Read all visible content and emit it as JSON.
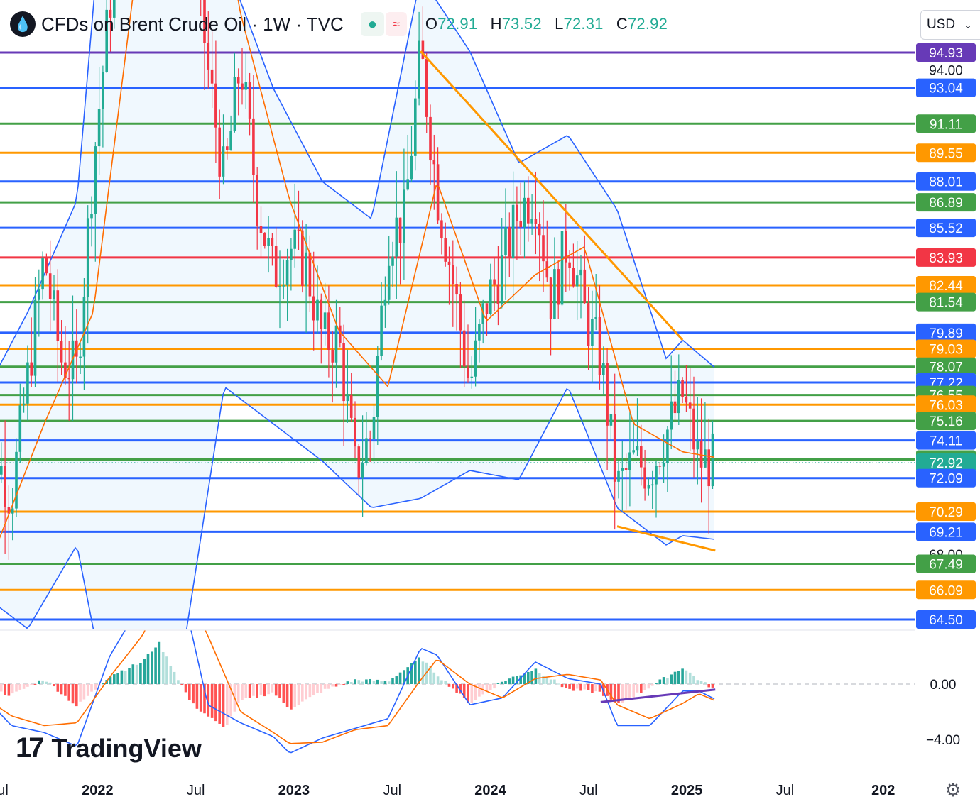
{
  "header": {
    "symbol_icon": "oil-drop-icon",
    "title": "CFDs on Brent Crude Oil · 1W · TVC",
    "indicator_status_icon": "dot-icon",
    "indicator_wave_icon": "wave-icon",
    "ohlc": {
      "o_label": "O",
      "o_value": "72.91",
      "h_label": "H",
      "h_value": "73.52",
      "l_label": "L",
      "l_value": "72.31",
      "c_label": "C",
      "c_value": "72.92"
    },
    "currency": "USD"
  },
  "brand": {
    "name": "TradingView",
    "mark": "17"
  },
  "settings_icon": "gear-icon",
  "colors": {
    "up": "#22ab94",
    "down": "#f23645",
    "bb": "#2962ff",
    "bb_fill": "#e3f2fd",
    "ema": "#ff6d00",
    "purple": "#673ab7",
    "blue": "#2962ff",
    "green": "#43a047",
    "orange": "#ff9800",
    "red": "#f23645",
    "trend": "#ff9800"
  },
  "chart_data": [
    {
      "type": "candlestick",
      "title": "CFDs on Brent Crude Oil · 1W · TVC",
      "x_ticks": [
        "Jul",
        "2022",
        "Jul",
        "2023",
        "Jul",
        "2024",
        "Jul",
        "2025",
        "Jul",
        "202"
      ],
      "y_ticks": [
        "94.00",
        "68.00"
      ],
      "last_price": 72.92,
      "price_levels": [
        {
          "value": 94.93,
          "label": "94.93",
          "color": "purple"
        },
        {
          "value": 93.04,
          "label": "93.04",
          "color": "blue"
        },
        {
          "value": 91.11,
          "label": "91.11",
          "color": "green"
        },
        {
          "value": 89.55,
          "label": "89.55",
          "color": "orange"
        },
        {
          "value": 88.01,
          "label": "88.01",
          "color": "blue"
        },
        {
          "value": 86.89,
          "label": "86.89",
          "color": "green"
        },
        {
          "value": 85.52,
          "label": "85.52",
          "color": "blue"
        },
        {
          "value": 83.93,
          "label": "83.93",
          "color": "red"
        },
        {
          "value": 82.44,
          "label": "82.44",
          "color": "orange"
        },
        {
          "value": 81.54,
          "label": "81.54",
          "color": "green"
        },
        {
          "value": 79.89,
          "label": "79.89",
          "color": "blue"
        },
        {
          "value": 79.03,
          "label": "79.03",
          "color": "orange"
        },
        {
          "value": 78.07,
          "label": "78.07",
          "color": "green"
        },
        {
          "value": 77.22,
          "label": "77.22",
          "color": "blue"
        },
        {
          "value": 76.55,
          "label": "76.55",
          "color": "green"
        },
        {
          "value": 76.03,
          "label": "76.03",
          "color": "orange"
        },
        {
          "value": 75.16,
          "label": "75.16",
          "color": "green"
        },
        {
          "value": 74.11,
          "label": "74.11",
          "color": "blue"
        },
        {
          "value": 73.09,
          "label": "73.09",
          "color": "green"
        },
        {
          "value": 72.92,
          "label": "72.92",
          "color": "last"
        },
        {
          "value": 72.09,
          "label": "72.09",
          "color": "blue"
        },
        {
          "value": 70.29,
          "label": "70.29",
          "color": "orange"
        },
        {
          "value": 69.21,
          "label": "69.21",
          "color": "blue"
        },
        {
          "value": 67.49,
          "label": "67.49",
          "color": "green"
        },
        {
          "value": 66.09,
          "label": "66.09",
          "color": "orange"
        },
        {
          "value": 64.5,
          "label": "64.50",
          "color": "blue"
        }
      ],
      "series": [
        {
          "kind": "candles",
          "close_path": [
            [
              "2021-06",
              75.5
            ],
            [
              "2021-07",
              73.5
            ],
            [
              "2021-08",
              71.0
            ],
            [
              "2021-09",
              77.5
            ],
            [
              "2021-10",
              84.0
            ],
            [
              "2021-11",
              78.5
            ],
            [
              "2021-12",
              77.8
            ],
            [
              "2022-01",
              89.0
            ],
            [
              "2022-02",
              97.5
            ],
            [
              "2022-03",
              106.0
            ],
            [
              "2022-04",
              107.0
            ],
            [
              "2022-05",
              118.0
            ],
            [
              "2022-06",
              114.0
            ],
            [
              "2022-07",
              102.0
            ],
            [
              "2022-08",
              94.0
            ],
            [
              "2022-09",
              88.0
            ],
            [
              "2022-10",
              94.5
            ],
            [
              "2022-11",
              87.0
            ],
            [
              "2022-12",
              83.0
            ],
            [
              "2023-01",
              84.5
            ],
            [
              "2023-02",
              83.5
            ],
            [
              "2023-03",
              79.5
            ],
            [
              "2023-04",
              79.5
            ],
            [
              "2023-05",
              72.5
            ],
            [
              "2023-06",
              74.5
            ],
            [
              "2023-07",
              85.0
            ],
            [
              "2023-08",
              86.0
            ],
            [
              "2023-09",
              95.0
            ],
            [
              "2023-10",
              87.5
            ],
            [
              "2023-11",
              82.5
            ],
            [
              "2023-12",
              77.0
            ],
            [
              "2024-01",
              81.5
            ],
            [
              "2024-02",
              83.5
            ],
            [
              "2024-03",
              86.5
            ],
            [
              "2024-04",
              87.5
            ],
            [
              "2024-05",
              81.5
            ],
            [
              "2024-06",
              85.0
            ],
            [
              "2024-07",
              81.0
            ],
            [
              "2024-08",
              78.5
            ],
            [
              "2024-09",
              71.5
            ],
            [
              "2024-10",
              73.0
            ],
            [
              "2024-11",
              72.5
            ],
            [
              "2024-12",
              74.5
            ],
            [
              "2025-01",
              76.5
            ],
            [
              "2025-02",
              73.0
            ],
            [
              "2025-03",
              72.92
            ]
          ]
        },
        {
          "kind": "bollinger",
          "upper": [
            [
              "2021-06",
              76.0
            ],
            [
              "2021-09",
              81.0
            ],
            [
              "2021-12",
              87.0
            ],
            [
              "2022-03",
              118.0
            ],
            [
              "2022-06",
              125.0
            ],
            [
              "2022-09",
              100.0
            ],
            [
              "2022-12",
              93.0
            ],
            [
              "2023-03",
              88.0
            ],
            [
              "2023-06",
              86.0
            ],
            [
              "2023-09",
              99.0
            ],
            [
              "2023-12",
              95.0
            ],
            [
              "2024-03",
              89.0
            ],
            [
              "2024-06",
              90.5
            ],
            [
              "2024-09",
              86.5
            ],
            [
              "2024-12",
              78.5
            ],
            [
              "2025-01",
              79.5
            ],
            [
              "2025-03",
              78.0
            ]
          ],
          "lower": [
            [
              "2021-06",
              66.0
            ],
            [
              "2021-09",
              64.0
            ],
            [
              "2021-12",
              68.5
            ],
            [
              "2022-03",
              55.0
            ],
            [
              "2022-06",
              60.0
            ],
            [
              "2022-09",
              77.0
            ],
            [
              "2022-12",
              75.0
            ],
            [
              "2023-03",
              73.0
            ],
            [
              "2023-06",
              70.5
            ],
            [
              "2023-09",
              71.0
            ],
            [
              "2023-12",
              72.5
            ],
            [
              "2024-03",
              72.0
            ],
            [
              "2024-06",
              77.0
            ],
            [
              "2024-09",
              70.5
            ],
            [
              "2024-12",
              68.5
            ],
            [
              "2025-01",
              69.0
            ],
            [
              "2025-03",
              68.8
            ]
          ]
        },
        {
          "kind": "ema",
          "values": [
            [
              "2021-06",
              66.0
            ],
            [
              "2021-10",
              75.0
            ],
            [
              "2022-01",
              81.0
            ],
            [
              "2022-04",
              102.0
            ],
            [
              "2022-07",
              112.0
            ],
            [
              "2022-10",
              97.0
            ],
            [
              "2023-01",
              87.0
            ],
            [
              "2023-04",
              80.0
            ],
            [
              "2023-07",
              77.0
            ],
            [
              "2023-10",
              88.0
            ],
            [
              "2024-01",
              80.5
            ],
            [
              "2024-04",
              83.0
            ],
            [
              "2024-07",
              84.5
            ],
            [
              "2024-10",
              75.0
            ],
            [
              "2025-01",
              73.5
            ],
            [
              "2025-03",
              73.2
            ]
          ]
        }
      ],
      "drawings": [
        {
          "kind": "trendline",
          "from": [
            "2023-09",
            95.0
          ],
          "to": [
            "2025-01",
            79.5
          ]
        },
        {
          "kind": "trendline",
          "from": [
            "2024-09",
            69.5
          ],
          "to": [
            "2025-03",
            68.2
          ]
        }
      ]
    },
    {
      "type": "macd",
      "y_ticks": [
        "0.00",
        "−4.00"
      ],
      "ylim": [
        -5.5,
        3.2
      ],
      "series": [
        {
          "kind": "histogram",
          "values": [
            [
              "2021-06",
              -0.2
            ],
            [
              "2021-08",
              -0.8
            ],
            [
              "2021-10",
              0.4
            ],
            [
              "2021-12",
              -1.6
            ],
            [
              "2022-02",
              0.6
            ],
            [
              "2022-04",
              1.6
            ],
            [
              "2022-05",
              3.0
            ],
            [
              "2022-07",
              -1.4
            ],
            [
              "2022-09",
              -3.2
            ],
            [
              "2022-10",
              -1.2
            ],
            [
              "2022-12",
              -0.6
            ],
            [
              "2023-01",
              -1.8
            ],
            [
              "2023-03",
              -0.5
            ],
            [
              "2023-05",
              0.3
            ],
            [
              "2023-07",
              0.2
            ],
            [
              "2023-09",
              1.9
            ],
            [
              "2023-10",
              0.7
            ],
            [
              "2023-12",
              -1.4
            ],
            [
              "2024-02",
              0.2
            ],
            [
              "2024-04",
              1.1
            ],
            [
              "2024-06",
              -0.4
            ],
            [
              "2024-08",
              -0.6
            ],
            [
              "2024-09",
              -1.5
            ],
            [
              "2024-11",
              -0.2
            ],
            [
              "2025-01",
              1.2
            ],
            [
              "2025-02",
              0.3
            ],
            [
              "2025-03",
              -0.4
            ]
          ]
        },
        {
          "kind": "macd_line",
          "values": [
            [
              "2021-06",
              -0.5
            ],
            [
              "2021-08",
              -3.0
            ],
            [
              "2021-10",
              -3.5
            ],
            [
              "2021-12",
              -4.5
            ],
            [
              "2022-02",
              2.0
            ],
            [
              "2022-04",
              6.0
            ],
            [
              "2022-06",
              9.0
            ],
            [
              "2022-08",
              -1.5
            ],
            [
              "2022-10",
              -2.8
            ],
            [
              "2022-12",
              -3.8
            ],
            [
              "2023-01",
              -5.0
            ],
            [
              "2023-03",
              -3.9
            ],
            [
              "2023-05",
              -3.2
            ],
            [
              "2023-07",
              -2.5
            ],
            [
              "2023-09",
              2.6
            ],
            [
              "2023-10",
              2.1
            ],
            [
              "2023-12",
              -1.5
            ],
            [
              "2024-02",
              -1.0
            ],
            [
              "2024-04",
              1.6
            ],
            [
              "2024-06",
              0.4
            ],
            [
              "2024-08",
              0.0
            ],
            [
              "2024-09",
              -3.0
            ],
            [
              "2024-11",
              -3.0
            ],
            [
              "2025-01",
              -0.5
            ],
            [
              "2025-02",
              -0.5
            ],
            [
              "2025-03",
              -1.1
            ]
          ]
        },
        {
          "kind": "signal_line",
          "values": [
            [
              "2021-06",
              -0.7
            ],
            [
              "2021-08",
              -2.3
            ],
            [
              "2021-10",
              -3.0
            ],
            [
              "2021-12",
              -2.8
            ],
            [
              "2022-02",
              0.5
            ],
            [
              "2022-04",
              3.5
            ],
            [
              "2022-06",
              8.5
            ],
            [
              "2022-08",
              3.5
            ],
            [
              "2022-10",
              -2.0
            ],
            [
              "2022-12",
              -3.5
            ],
            [
              "2023-01",
              -4.3
            ],
            [
              "2023-03",
              -4.2
            ],
            [
              "2023-05",
              -3.3
            ],
            [
              "2023-07",
              -3.0
            ],
            [
              "2023-09",
              0.3
            ],
            [
              "2023-10",
              1.8
            ],
            [
              "2023-12",
              0.0
            ],
            [
              "2024-02",
              -1.0
            ],
            [
              "2024-04",
              0.4
            ],
            [
              "2024-06",
              0.7
            ],
            [
              "2024-08",
              0.3
            ],
            [
              "2024-09",
              -1.5
            ],
            [
              "2024-11",
              -2.5
            ],
            [
              "2025-01",
              -1.4
            ],
            [
              "2025-02",
              -0.7
            ],
            [
              "2025-03",
              -1.2
            ]
          ]
        }
      ],
      "drawings": [
        {
          "kind": "trendline",
          "from": [
            "2024-08",
            -1.3
          ],
          "to": [
            "2025-03",
            -0.4
          ]
        }
      ]
    }
  ]
}
